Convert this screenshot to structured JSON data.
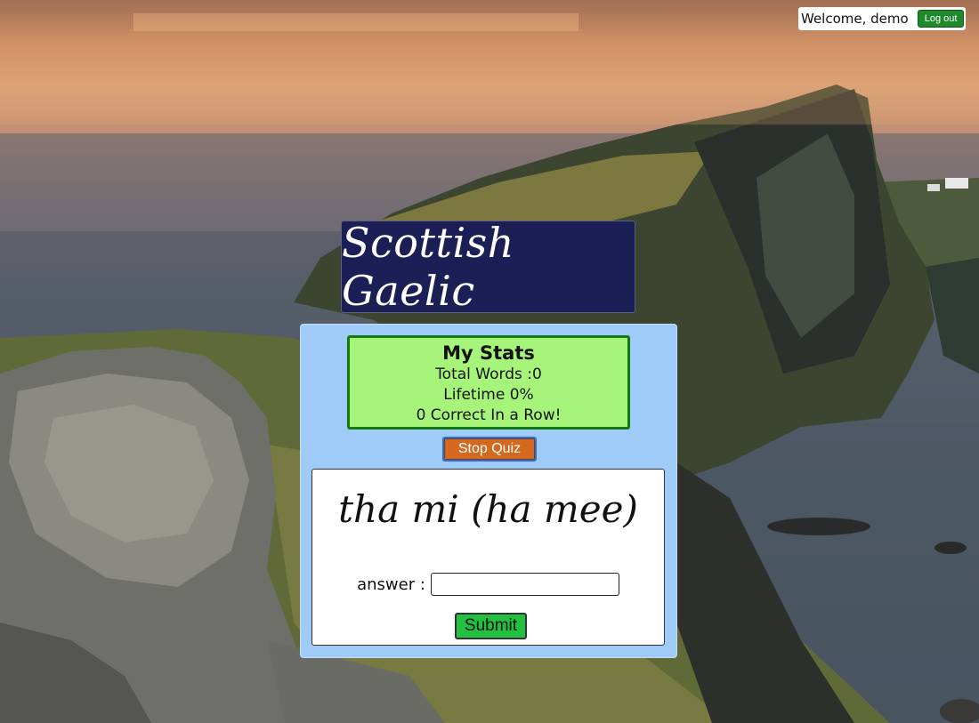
{
  "header": {
    "welcome_text": "Welcome, demo",
    "logout_label": "Log out"
  },
  "title": {
    "text": "Scottish Gaelic"
  },
  "stats": {
    "heading": "My Stats",
    "total_words": "Total Words :0",
    "lifetime": "Lifetime 0%",
    "streak": "0 Correct In a Row!"
  },
  "quiz": {
    "stop_label": "Stop Quiz",
    "word": "tha mi (ha mee)",
    "answer_label": "answer :",
    "answer_value": "",
    "answer_placeholder": "",
    "submit_label": "Submit"
  },
  "colors": {
    "title_bg": "#1c1f55",
    "panel_bg": "#9fcbf8",
    "stats_bg": "#a6f57a",
    "stats_border": "#127a10",
    "stop_button": "#d2691e",
    "submit_button": "#22c240",
    "logout_button": "#1f8a2c"
  },
  "background": {
    "scene": "coastal-cliffs-sunset"
  }
}
